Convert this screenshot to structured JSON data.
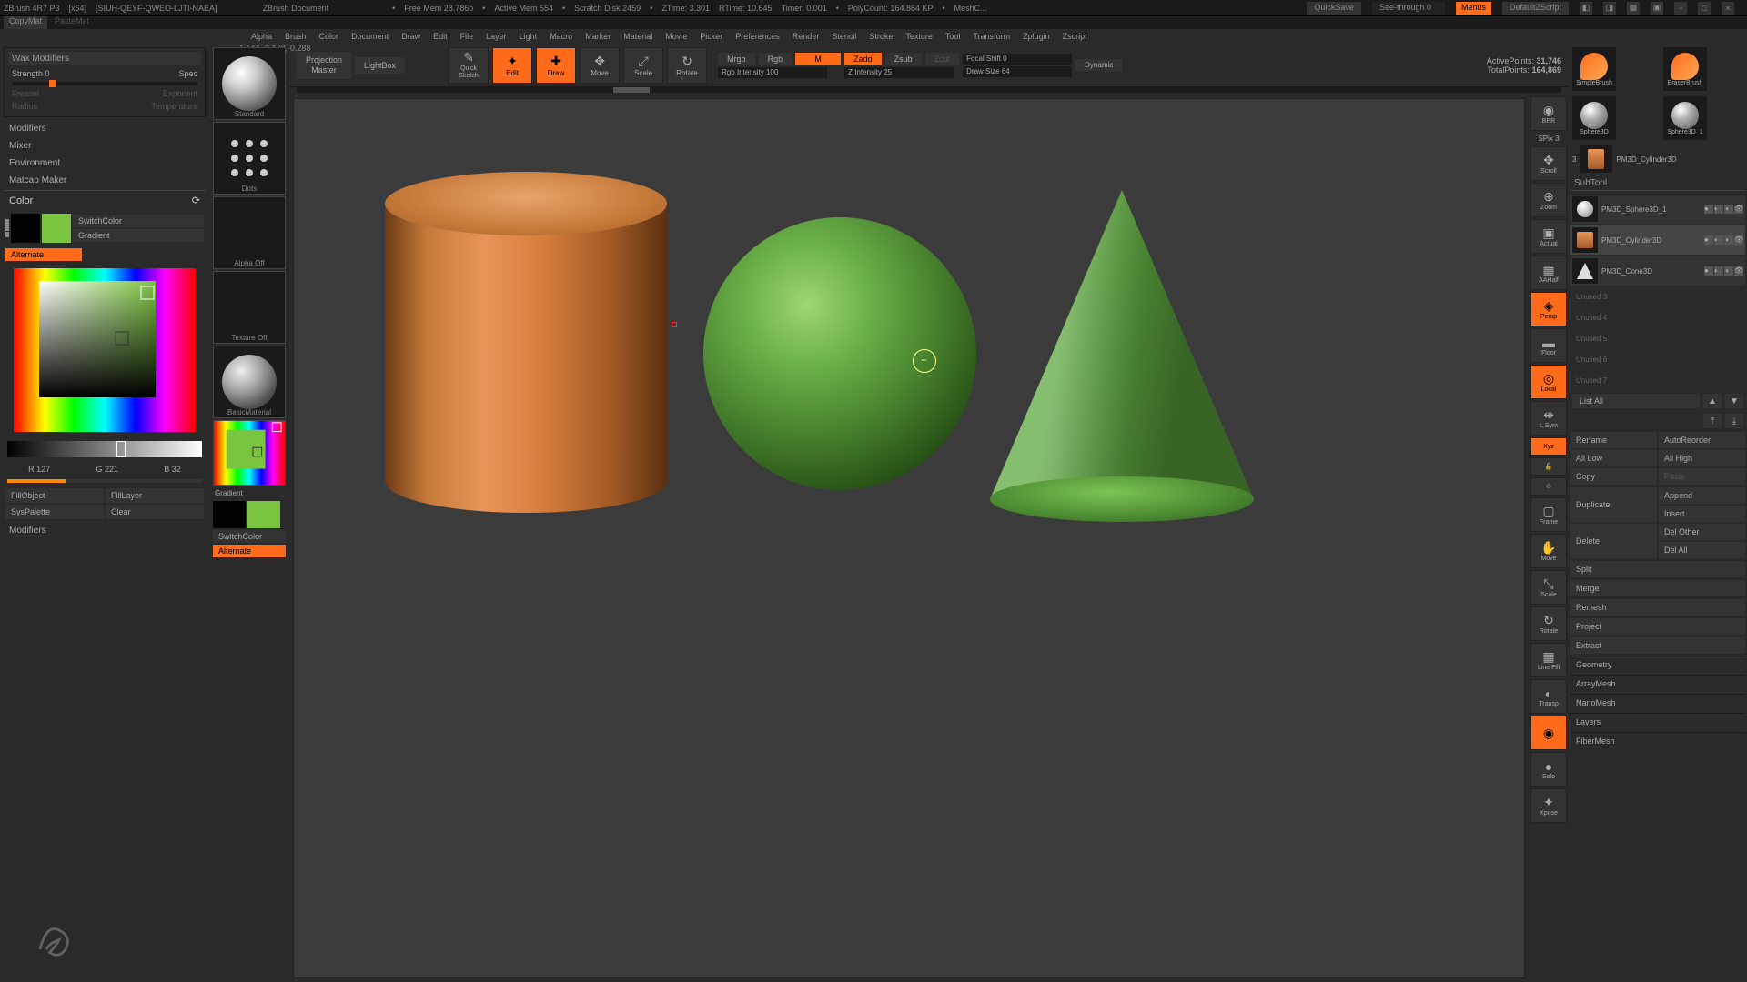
{
  "title": {
    "app": "ZBrush 4R7 P3",
    "arch": "[x64]",
    "doc_id": "[SIUH-QEYF-QWEO-LJTI-NAEA]",
    "doc": "ZBrush Document",
    "free_mem": "Free Mem 28.786b",
    "active_mem": "Active Mem 554",
    "scratch": "Scratch Disk 2459",
    "ztime": "ZTime: 3.301",
    "rtime": "RTime: 10.645",
    "timer": "Timer: 0.001",
    "polycount": "PolyCount: 164.864 KP",
    "mesh": "MeshC...",
    "quicksave": "QuickSave",
    "seethrough": "See-through   0",
    "menus": "Menus",
    "default": "DefaultZScript"
  },
  "row2": {
    "copymat": "CopyMat",
    "pastemat": "PasteMat"
  },
  "menu": [
    "Alpha",
    "Brush",
    "Color",
    "Document",
    "Draw",
    "Edit",
    "File",
    "Layer",
    "Light",
    "Macro",
    "Marker",
    "Material",
    "Movie",
    "Picker",
    "Preferences",
    "Render",
    "Stencil",
    "Stroke",
    "Texture",
    "Tool",
    "Transform",
    "Zplugin",
    "Zscript"
  ],
  "coords": "-1.144,-0.178,-0.288",
  "left": {
    "wax_modifiers": "Wax Modifiers",
    "strength": "Strength 0",
    "spec": "Spec",
    "fresnel": "Fresnel",
    "exponent": "Exponent",
    "radius": "Radius",
    "temperature": "Temperature",
    "modifiers": "Modifiers",
    "mixer": "Mixer",
    "environment": "Environment",
    "matcap_maker": "Matcap Maker",
    "color": "Color",
    "switch_color": "SwitchColor",
    "gradient": "Gradient",
    "alternate": "Alternate",
    "r": "R 127",
    "g": "G 221",
    "b": "B 32",
    "fill_object": "FillObject",
    "fill_layer": "FillLayer",
    "sys_palette": "SysPalette",
    "clear": "Clear",
    "modifiers2": "Modifiers"
  },
  "brush": {
    "standard": "Standard",
    "dots": "Dots",
    "alpha_off": "Alpha Off",
    "texture_off": "Texture Off",
    "basic_material": "BasicMaterial",
    "gradient": "Gradient",
    "switch_color": "SwitchColor",
    "alternate": "Alternate"
  },
  "toolbar": {
    "projection": "Projection\nMaster",
    "lightbox": "LightBox",
    "quick_sketch": "Quick\nSketch",
    "edit": "Edit",
    "draw": "Draw",
    "move": "Move",
    "scale": "Scale",
    "rotate": "Rotate",
    "mrgb": "Mrgb",
    "rgb": "Rgb",
    "m": "M",
    "rgb_intensity": "Rgb Intensity 100",
    "zadd": "Zadd",
    "zsub": "Zsub",
    "zcut": "Zcut",
    "z_intensity": "Z Intensity 25",
    "focal_shift": "Focal Shift 0",
    "draw_size": "Draw Size 64",
    "dynamic": "Dynamic",
    "active_points": "ActivePoints:",
    "active_points_val": "31,746",
    "total_points": "TotalPoints:",
    "total_points_val": "164,869"
  },
  "rail": {
    "spix": "SPix 3",
    "bpr": "BPR",
    "scroll": "Scroll",
    "zoom": "Zoom",
    "actual": "Actual",
    "aahalf": "AAHalf",
    "persp": "Persp",
    "floor": "Floor",
    "local": "Local",
    "lsym": "L.Sym",
    "xyz": "Xyz",
    "frame": "Frame",
    "move": "Move",
    "scale": "Scale",
    "rotate": "Rotate",
    "polyf": "Line Fill",
    "transp": "Transp",
    "ghost": "",
    "solo": "Solo",
    "xpose": "Xpose"
  },
  "right": {
    "simple_brush": "SimpleBrush",
    "eraser_brush": "EraserBrush",
    "sphere3d": "Sphere3D",
    "sphere3d1": "Sphere3D_1",
    "pm3d_cylinder": "PM3D_Cylinder3D",
    "subtool": "SubTool",
    "st1": "PM3D_Sphere3D_1",
    "st2": "PM3D_Cylinder3D",
    "st3": "PM3D_Cone3D",
    "unused3": "Unused 3",
    "unused4": "Unused 4",
    "unused5": "Unused 5",
    "unused6": "Unused 6",
    "unused7": "Unused 7",
    "list_all": "List All",
    "rename": "Rename",
    "auto_reorder": "AutoReorder",
    "all_low": "All Low",
    "all_high": "All High",
    "copy": "Copy",
    "paste": "Paste",
    "duplicate": "Duplicate",
    "append": "Append",
    "insert": "Insert",
    "delete": "Delete",
    "del_other": "Del Other",
    "del_all": "Del All",
    "split": "Split",
    "merge": "Merge",
    "remesh": "Remesh",
    "project": "Project",
    "extract": "Extract",
    "geometry": "Geometry",
    "arraymesh": "ArrayMesh",
    "nanomesh": "NanoMesh",
    "layers": "Layers",
    "fibermesh": "FiberMesh"
  }
}
